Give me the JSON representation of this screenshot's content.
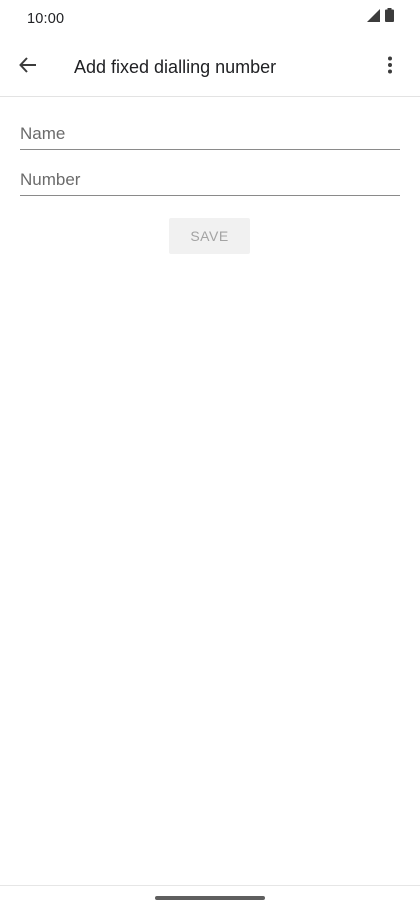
{
  "status_bar": {
    "time": "10:00",
    "icons": [
      "signal-icon",
      "battery-icon"
    ]
  },
  "app_bar": {
    "title": "Add fixed dialling number",
    "back_icon": "arrow-back-icon",
    "more_icon": "more-vert-icon"
  },
  "form": {
    "name_placeholder": "Name",
    "name_value": "",
    "number_placeholder": "Number",
    "number_value": "",
    "save_label": "SAVE"
  },
  "colors": {
    "text": "#202124",
    "placeholder": "#6b6b6b",
    "button_disabled_bg": "#f1f1f1",
    "button_disabled_text": "#a3a3a3",
    "underline": "#8a8a8a"
  }
}
